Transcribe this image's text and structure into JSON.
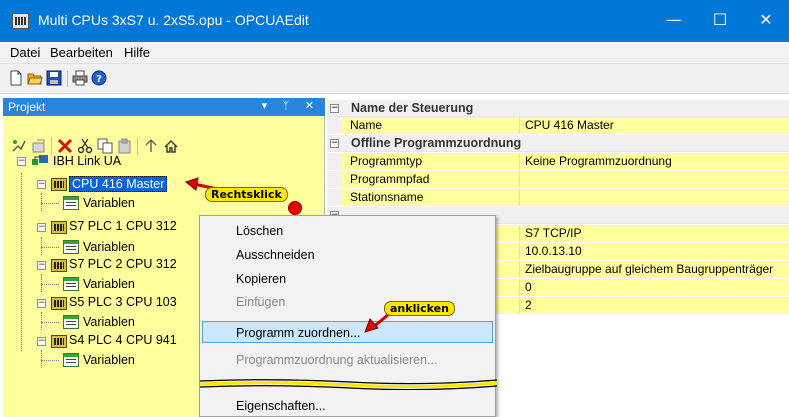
{
  "window": {
    "title": "Multi CPUs 3xS7 u. 2xS5.opu - OPCUAEdit",
    "minimize": "—",
    "maximize": "☐",
    "close": "✕"
  },
  "menu": [
    "Datei",
    "Bearbeiten",
    "Hilfe"
  ],
  "toolbar_icons": [
    "new-file-icon",
    "open-folder-icon",
    "save-icon",
    "print-icon",
    "help-icon"
  ],
  "panel": {
    "title": "Projekt",
    "buttons": "▾ ᛘ ✕",
    "tools": [
      "tool-a-icon",
      "tool-b-icon",
      "delete-icon",
      "cut-icon",
      "copy-icon",
      "paste-icon",
      "move-up-icon",
      "home-icon"
    ]
  },
  "tree": {
    "root": "IBH Link UA",
    "nodes": [
      {
        "label": "CPU 416 Master",
        "child": "Variablen",
        "selected": true
      },
      {
        "label": "S7 PLC 1 CPU 312",
        "child": "Variablen"
      },
      {
        "label": "S7 PLC 2 CPU 312",
        "child": "Variablen"
      },
      {
        "label": "S5 PLC 3 CPU 103",
        "child": "Variablen"
      },
      {
        "label": "S4 PLC 4 CPU 941",
        "child": "Variablen"
      }
    ]
  },
  "grid": {
    "cat1": "Name der Steuerung",
    "name_key": "Name",
    "name_val": "CPU 416 Master",
    "cat2": "Offline Programmzuordnung",
    "rows": [
      {
        "key": "Programmtyp",
        "val": "Keine Programmzuordnung"
      },
      {
        "key": "Programmpfad",
        "val": ""
      },
      {
        "key": "Stationsname",
        "val": ""
      }
    ],
    "more_vals": [
      "S7 TCP/IP",
      "10.0.13.10",
      "Zielbaugruppe auf gleichem Baugruppenträger",
      "0",
      "2"
    ]
  },
  "context_menu": {
    "items": [
      {
        "label": "Löschen",
        "disabled": false
      },
      {
        "label": "Ausschneiden",
        "disabled": false
      },
      {
        "label": "Kopieren",
        "disabled": false
      },
      {
        "label": "Einfügen",
        "disabled": true
      },
      {
        "label": "Programm zuordnen...",
        "disabled": false,
        "highlighted": true
      },
      {
        "label": "Programmzuordnung aktualisieren...",
        "disabled": true
      },
      {
        "label": "Eigenschaften...",
        "disabled": false
      }
    ]
  },
  "annotations": {
    "right_click": "Rechtsklick",
    "click": "anklicken"
  },
  "colors": {
    "titlebar": "#0078d7",
    "panel_bg": "#ffff9d",
    "selection": "#0a64d8",
    "callout": "#ffe600",
    "marker": "#e00000"
  }
}
